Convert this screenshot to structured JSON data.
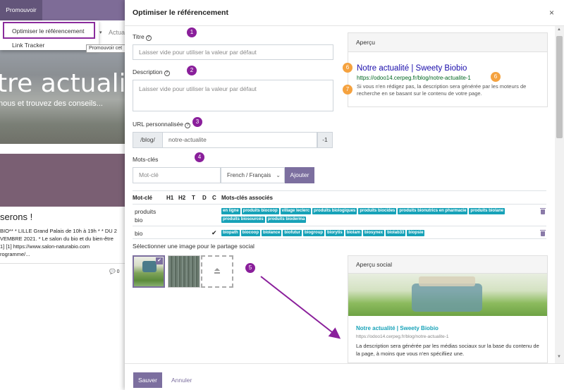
{
  "background": {
    "menu_button": "Promouvoir",
    "menu_items": [
      "Optimiser le référencement",
      "Link Tracker"
    ],
    "nav_partial": "Actua",
    "tooltip": "Promouvoir cet",
    "hero_title": "tre actualité",
    "hero_subtitle": "nous et trouvez des conseils...",
    "post_title": "serons !",
    "post_text": "BIO** * LILLE Grand Palais de 10h à 19h * * DU 2\nVEMBRE 2021. * Le salon du bio et du bien-être\n1] [1] https://www.salon-naturabio.com\nrogramme/...",
    "comment_count": "0"
  },
  "modal": {
    "title": "Optimiser le référencement",
    "close_glyph": "×",
    "title_field": {
      "label": "Titre",
      "placeholder": "Laisser vide pour utiliser la valeur par défaut"
    },
    "description_field": {
      "label": "Description",
      "placeholder": "Laisser vide pour utiliser la valeur par défaut"
    },
    "url_field": {
      "label": "URL personnalisée",
      "prefix": "/blog/",
      "value": "notre-actualite",
      "suffix": "-1"
    },
    "keywords": {
      "label": "Mots-clés",
      "placeholder": "Mot-clé",
      "language": "French / Français",
      "add_button": "Ajouter",
      "headers": [
        "Mot-clé",
        "H1",
        "H2",
        "T",
        "D",
        "C",
        "Mots-clés associés"
      ],
      "rows": [
        {
          "keyword": "produits bio",
          "keyword_line1": "produits",
          "keyword_line2": "bio",
          "c_check": "",
          "tags": [
            "en ligne",
            "produits biocoop",
            "village leclerc",
            "produits biologiques",
            "produits biocides",
            "produits bionutrics en pharmacie",
            "produits biolane",
            "produits biosourcés",
            "produits bioderma"
          ]
        },
        {
          "keyword": "bio",
          "c_check": "✔",
          "tags": [
            "biopath",
            "biocoop",
            "biolance",
            "biofutur",
            "biogroup",
            "biorytis",
            "biolam",
            "biosynex",
            "biolab33",
            "biopsie"
          ]
        }
      ]
    },
    "preview": {
      "heading": "Aperçu",
      "title": "Notre actualité | Sweety Biobio",
      "url": "https://odoo14.cerpeg.fr/blog/notre-actualite-1",
      "description": "Si vous n'en rédigez pas, la description sera générée par les moteurs de recherche en se basant sur le contenu de votre page."
    },
    "social": {
      "label": "Sélectionner une image pour le partage social",
      "preview_heading": "Aperçu social",
      "title": "Notre actualité | Sweety Biobio",
      "url": "https://odoo14.cerpeg.fr/blog/notre-actualite-1",
      "description": "La description sera générée par les médias sociaux sur la base du contenu de la page, à moins que vous n'en spécifiiez une."
    },
    "footer": {
      "save": "Sauver",
      "cancel": "Annuler"
    }
  },
  "annotations": {
    "numbers": [
      "1",
      "2",
      "3",
      "4",
      "5",
      "6",
      "6",
      "7"
    ],
    "purple_color": "#8a1f9b",
    "orange_color": "#f5a23f"
  },
  "colors": {
    "accent": "#7c6f9f",
    "topbar": "#7e6c97",
    "tag": "#17a2b8",
    "link_title": "#1a0dab",
    "link_url": "#006621"
  }
}
